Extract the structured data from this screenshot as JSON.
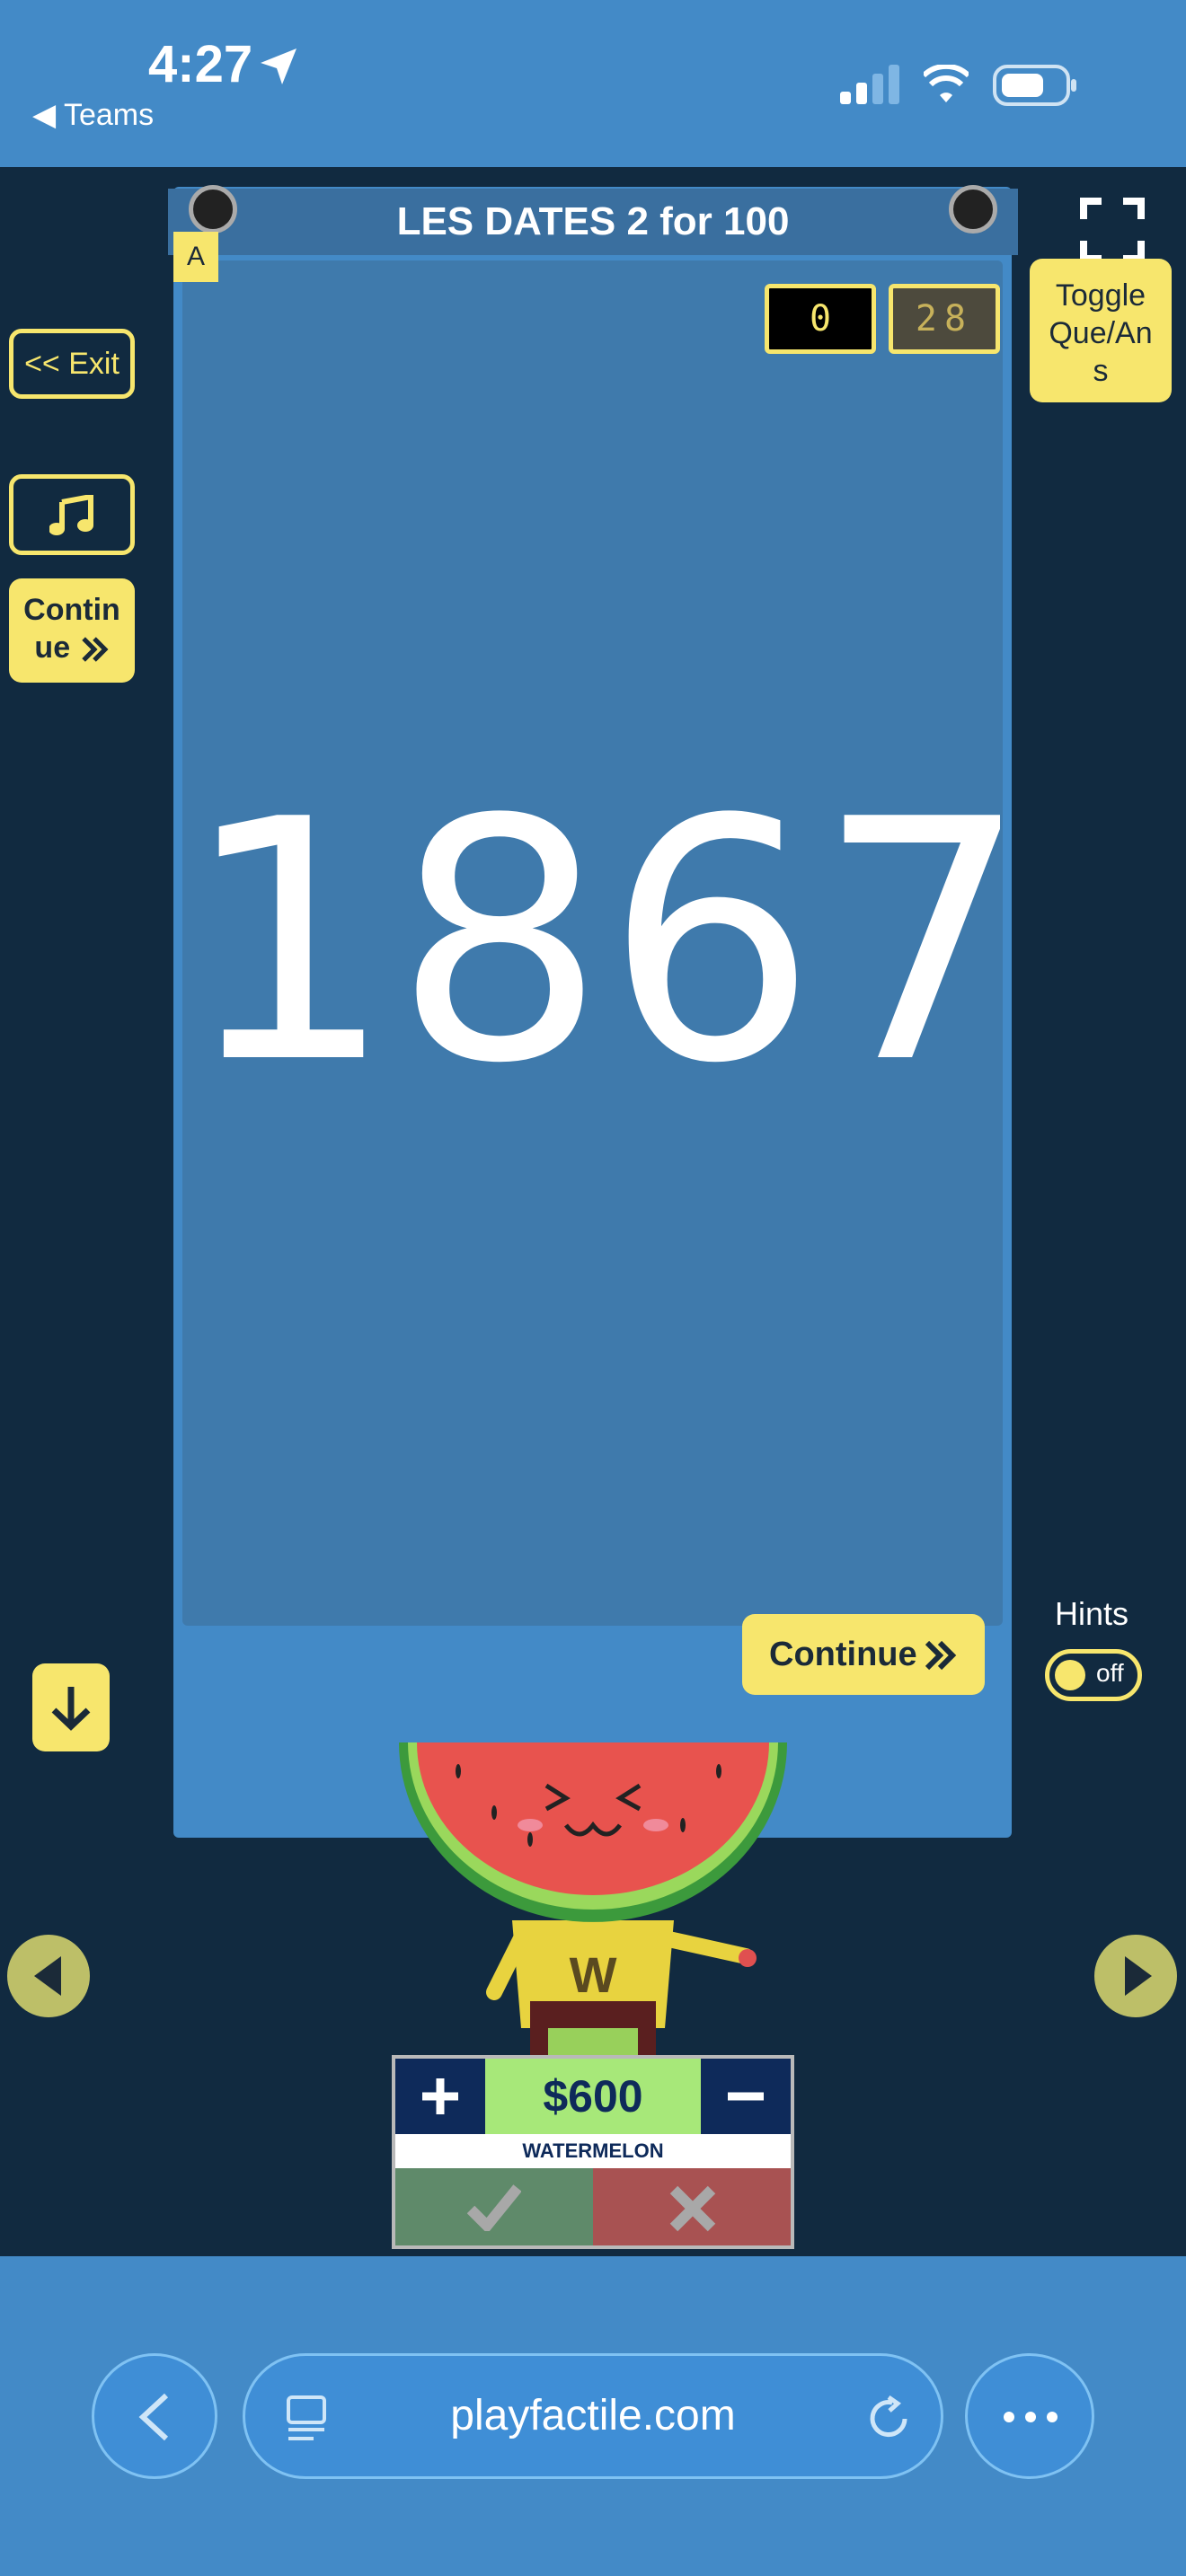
{
  "status_bar": {
    "time": "4:27",
    "back_label": "◀ Teams"
  },
  "game": {
    "title": "LES DATES 2 for 100",
    "corner_badge": "A",
    "score_left": "0",
    "score_right": "28",
    "answer_text": "1867",
    "continue_label": "Continue",
    "hints_label": "Hints",
    "hints_state": "off"
  },
  "left_panel": {
    "exit_label": "<< Exit",
    "continue_label_line1": "Contin",
    "continue_label_line2": "ue"
  },
  "right_panel": {
    "toggle_line1": "Toggle",
    "toggle_line2": "Que/An",
    "toggle_line3": "s"
  },
  "team": {
    "amount": "$600",
    "name": "WATERMELON",
    "avatar_letter": "W"
  },
  "browser": {
    "url": "playfactile.com"
  },
  "colors": {
    "accent_yellow": "#f7e66d",
    "page_bg": "#112a40",
    "board_blue": "#438ac7",
    "card_blue": "#3f7aac"
  }
}
